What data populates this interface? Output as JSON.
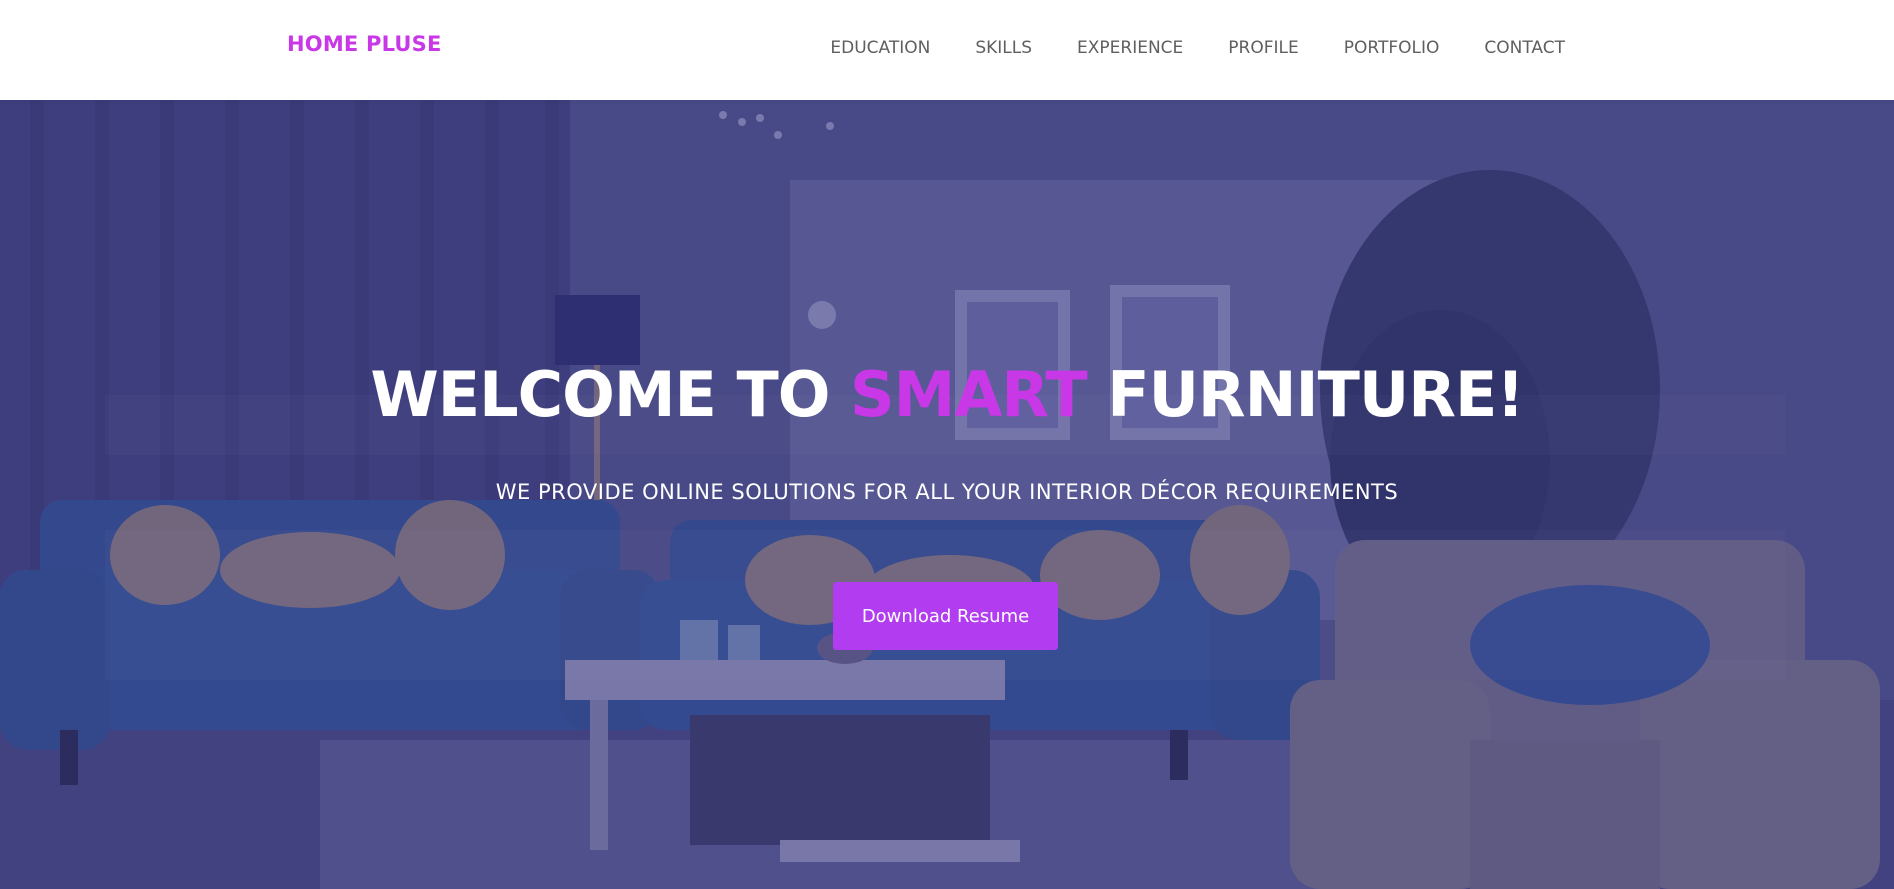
{
  "colors": {
    "accent": "#c938e6",
    "button_bg": "#b13cf0",
    "nav_text": "#5f5f5f",
    "overlay": "#3a377d"
  },
  "brand": {
    "name": "HOME PLUSE"
  },
  "nav": {
    "items": [
      {
        "label": "EDUCATION"
      },
      {
        "label": "SKILLS"
      },
      {
        "label": "EXPERIENCE"
      },
      {
        "label": "PROFILE"
      },
      {
        "label": "PORTFOLIO"
      },
      {
        "label": "CONTACT"
      }
    ]
  },
  "hero": {
    "title_prefix": "WELCOME TO ",
    "title_highlight": "SMART",
    "title_suffix": " FURNITURE!",
    "subtitle": "WE PROVIDE ONLINE SOLUTIONS FOR ALL YOUR INTERIOR DÉCOR REQUIREMENTS",
    "cta_label": "Download Resume",
    "background": "living-room-photo"
  }
}
